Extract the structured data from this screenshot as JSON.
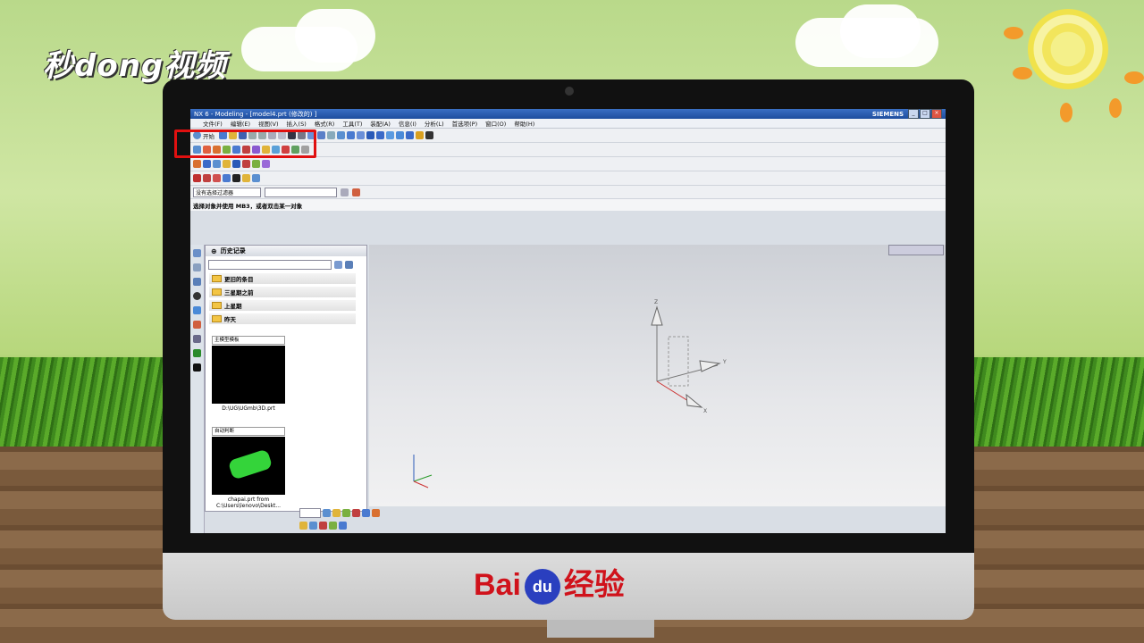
{
  "watermark": {
    "top_logo": "秒dong视频",
    "brand": "Bai",
    "brand_paw": "du",
    "brand_suffix": "经验"
  },
  "window": {
    "title": "NX 6 - Modeling - [model4.prt  (修改的)  ]",
    "brand": "SIEMENS",
    "controls": [
      "_",
      "□",
      "×"
    ]
  },
  "menu": [
    "文件(F)",
    "编辑(E)",
    "视图(V)",
    "插入(S)",
    "格式(R)",
    "工具(T)",
    "装配(A)",
    "信息(I)",
    "分析(L)",
    "首选项(P)",
    "窗口(O)",
    "帮助(H)"
  ],
  "toolbar": {
    "start_label": "开始"
  },
  "filter": {
    "selection_filter": "没有选择过滤器",
    "scope": ""
  },
  "status_text": "选择对象并使用 MB3，或者双击某一对象",
  "history_panel": {
    "title": "历史记录",
    "groups": [
      "更旧的条目",
      "三星期之前",
      "上星期",
      "昨天"
    ],
    "items": [
      {
        "combo": "主模型模板",
        "caption": "D:\\UG\\UGmb\\3D.prt",
        "preview_color": "#000000"
      },
      {
        "combo": "自动判断",
        "caption": "chapai.prt from C:\\Users\\lenovo\\Deskt...",
        "preview_color": "#34d43a"
      }
    ]
  },
  "viewport": {
    "axes": [
      "Z",
      "Y",
      "X"
    ]
  },
  "colors": {
    "highlight": "#e01010",
    "accent": "#1e4d9e"
  }
}
